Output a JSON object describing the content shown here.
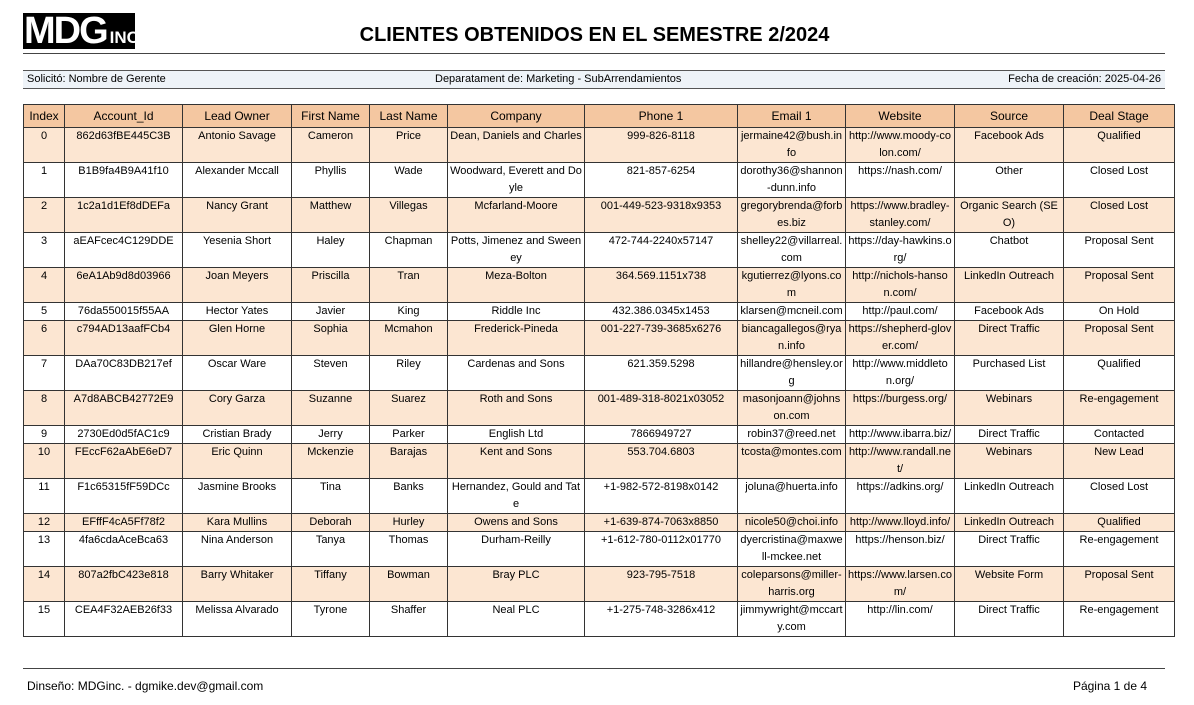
{
  "logo": {
    "main": "MDG",
    "suffix": "INC"
  },
  "title": "CLIENTES OBTENIDOS EN EL SEMESTRE 2/2024",
  "info": {
    "requested_by": "Solicitó: Nombre de Gerente",
    "department": "Deparatament de: Marketing - SubArrendamientos",
    "created": "Fecha de creación: 2025-04-26"
  },
  "table": {
    "headers": [
      "Index",
      "Account_Id",
      "Lead Owner",
      "First Name",
      "Last Name",
      "Company",
      "Phone 1",
      "Email 1",
      "Website",
      "Source",
      "Deal Stage"
    ],
    "rows": [
      [
        "0",
        "862d63fBE445C3B",
        "Antonio Savage",
        "Cameron",
        "Price",
        "Dean, Daniels and Charles",
        "999-826-8118",
        "jermaine42@bush.info",
        "http://www.moody-colon.com/",
        "Facebook Ads",
        "Qualified"
      ],
      [
        "1",
        "B1B9fa4B9A41f10",
        "Alexander Mccall",
        "Phyllis",
        "Wade",
        "Woodward, Everett and Doyle",
        "821-857-6254",
        "dorothy36@shannon-dunn.info",
        "https://nash.com/",
        "Other",
        "Closed Lost"
      ],
      [
        "2",
        "1c2a1d1Ef8dDEFa",
        "Nancy Grant",
        "Matthew",
        "Villegas",
        "Mcfarland-Moore",
        "001-449-523-9318x9353",
        "gregorybrenda@forbes.biz",
        "https://www.bradley-stanley.com/",
        "Organic Search (SEO)",
        "Closed Lost"
      ],
      [
        "3",
        "aEAFcec4C129DDE",
        "Yesenia Short",
        "Haley",
        "Chapman",
        "Potts, Jimenez and Sweeney",
        "472-744-2240x57147",
        "shelley22@villarreal.com",
        "https://day-hawkins.org/",
        "Chatbot",
        "Proposal Sent"
      ],
      [
        "4",
        "6eA1Ab9d8d03966",
        "Joan Meyers",
        "Priscilla",
        "Tran",
        "Meza-Bolton",
        "364.569.1151x738",
        "kgutierrez@lyons.com",
        "http://nichols-hanson.com/",
        "LinkedIn Outreach",
        "Proposal Sent"
      ],
      [
        "5",
        "76da550015f55AA",
        "Hector Yates",
        "Javier",
        "King",
        "Riddle Inc",
        "432.386.0345x1453",
        "klarsen@mcneil.com",
        "http://paul.com/",
        "Facebook Ads",
        "On Hold"
      ],
      [
        "6",
        "c794AD13aafFCb4",
        "Glen Horne",
        "Sophia",
        "Mcmahon",
        "Frederick-Pineda",
        "001-227-739-3685x6276",
        "biancagallegos@ryan.info",
        "https://shepherd-glover.com/",
        "Direct Traffic",
        "Proposal Sent"
      ],
      [
        "7",
        "DAa70C83DB217ef",
        "Oscar Ware",
        "Steven",
        "Riley",
        "Cardenas and Sons",
        "621.359.5298",
        "hillandre@hensley.org",
        "http://www.middleton.org/",
        "Purchased List",
        "Qualified"
      ],
      [
        "8",
        "A7d8ABCB42772E9",
        "Cory Garza",
        "Suzanne",
        "Suarez",
        "Roth and Sons",
        "001-489-318-8021x03052",
        "masonjoann@johnson.com",
        "https://burgess.org/",
        "Webinars",
        "Re-engagement"
      ],
      [
        "9",
        "2730Ed0d5fAC1c9",
        "Cristian Brady",
        "Jerry",
        "Parker",
        "English Ltd",
        "7866949727",
        "robin37@reed.net",
        "http://www.ibarra.biz/",
        "Direct Traffic",
        "Contacted"
      ],
      [
        "10",
        "FEccF62aAbE6eD7",
        "Eric Quinn",
        "Mckenzie",
        "Barajas",
        "Kent and Sons",
        "553.704.6803",
        "tcosta@montes.com",
        "http://www.randall.net/",
        "Webinars",
        "New Lead"
      ],
      [
        "11",
        "F1c65315fF59DCc",
        "Jasmine Brooks",
        "Tina",
        "Banks",
        "Hernandez, Gould and Tate",
        "+1-982-572-8198x0142",
        "joluna@huerta.info",
        "https://adkins.org/",
        "LinkedIn Outreach",
        "Closed Lost"
      ],
      [
        "12",
        "EFffF4cA5Ff78f2",
        "Kara Mullins",
        "Deborah",
        "Hurley",
        "Owens and Sons",
        "+1-639-874-7063x8850",
        "nicole50@choi.info",
        "http://www.lloyd.info/",
        "LinkedIn Outreach",
        "Qualified"
      ],
      [
        "13",
        "4fa6cdaAceBca63",
        "Nina Anderson",
        "Tanya",
        "Thomas",
        "Durham-Reilly",
        "+1-612-780-0112x01770",
        "dyercristina@maxwell-mckee.net",
        "https://henson.biz/",
        "Direct Traffic",
        "Re-engagement"
      ],
      [
        "14",
        "807a2fbC423e818",
        "Barry Whitaker",
        "Tiffany",
        "Bowman",
        "Bray PLC",
        "923-795-7518",
        "coleparsons@miller-harris.org",
        "https://www.larsen.com/",
        "Website Form",
        "Proposal Sent"
      ],
      [
        "15",
        "CEA4F32AEB26f33",
        "Melissa Alvarado",
        "Tyrone",
        "Shaffer",
        "Neal PLC",
        "+1-275-748-3286x412",
        "jimmywright@mccarty.com",
        "http://lin.com/",
        "Direct Traffic",
        "Re-engagement"
      ]
    ]
  },
  "footer": {
    "design": "Dinseño: MDGinc. - dgmike.dev@gmail.com",
    "page": "Página 1 de 4"
  }
}
